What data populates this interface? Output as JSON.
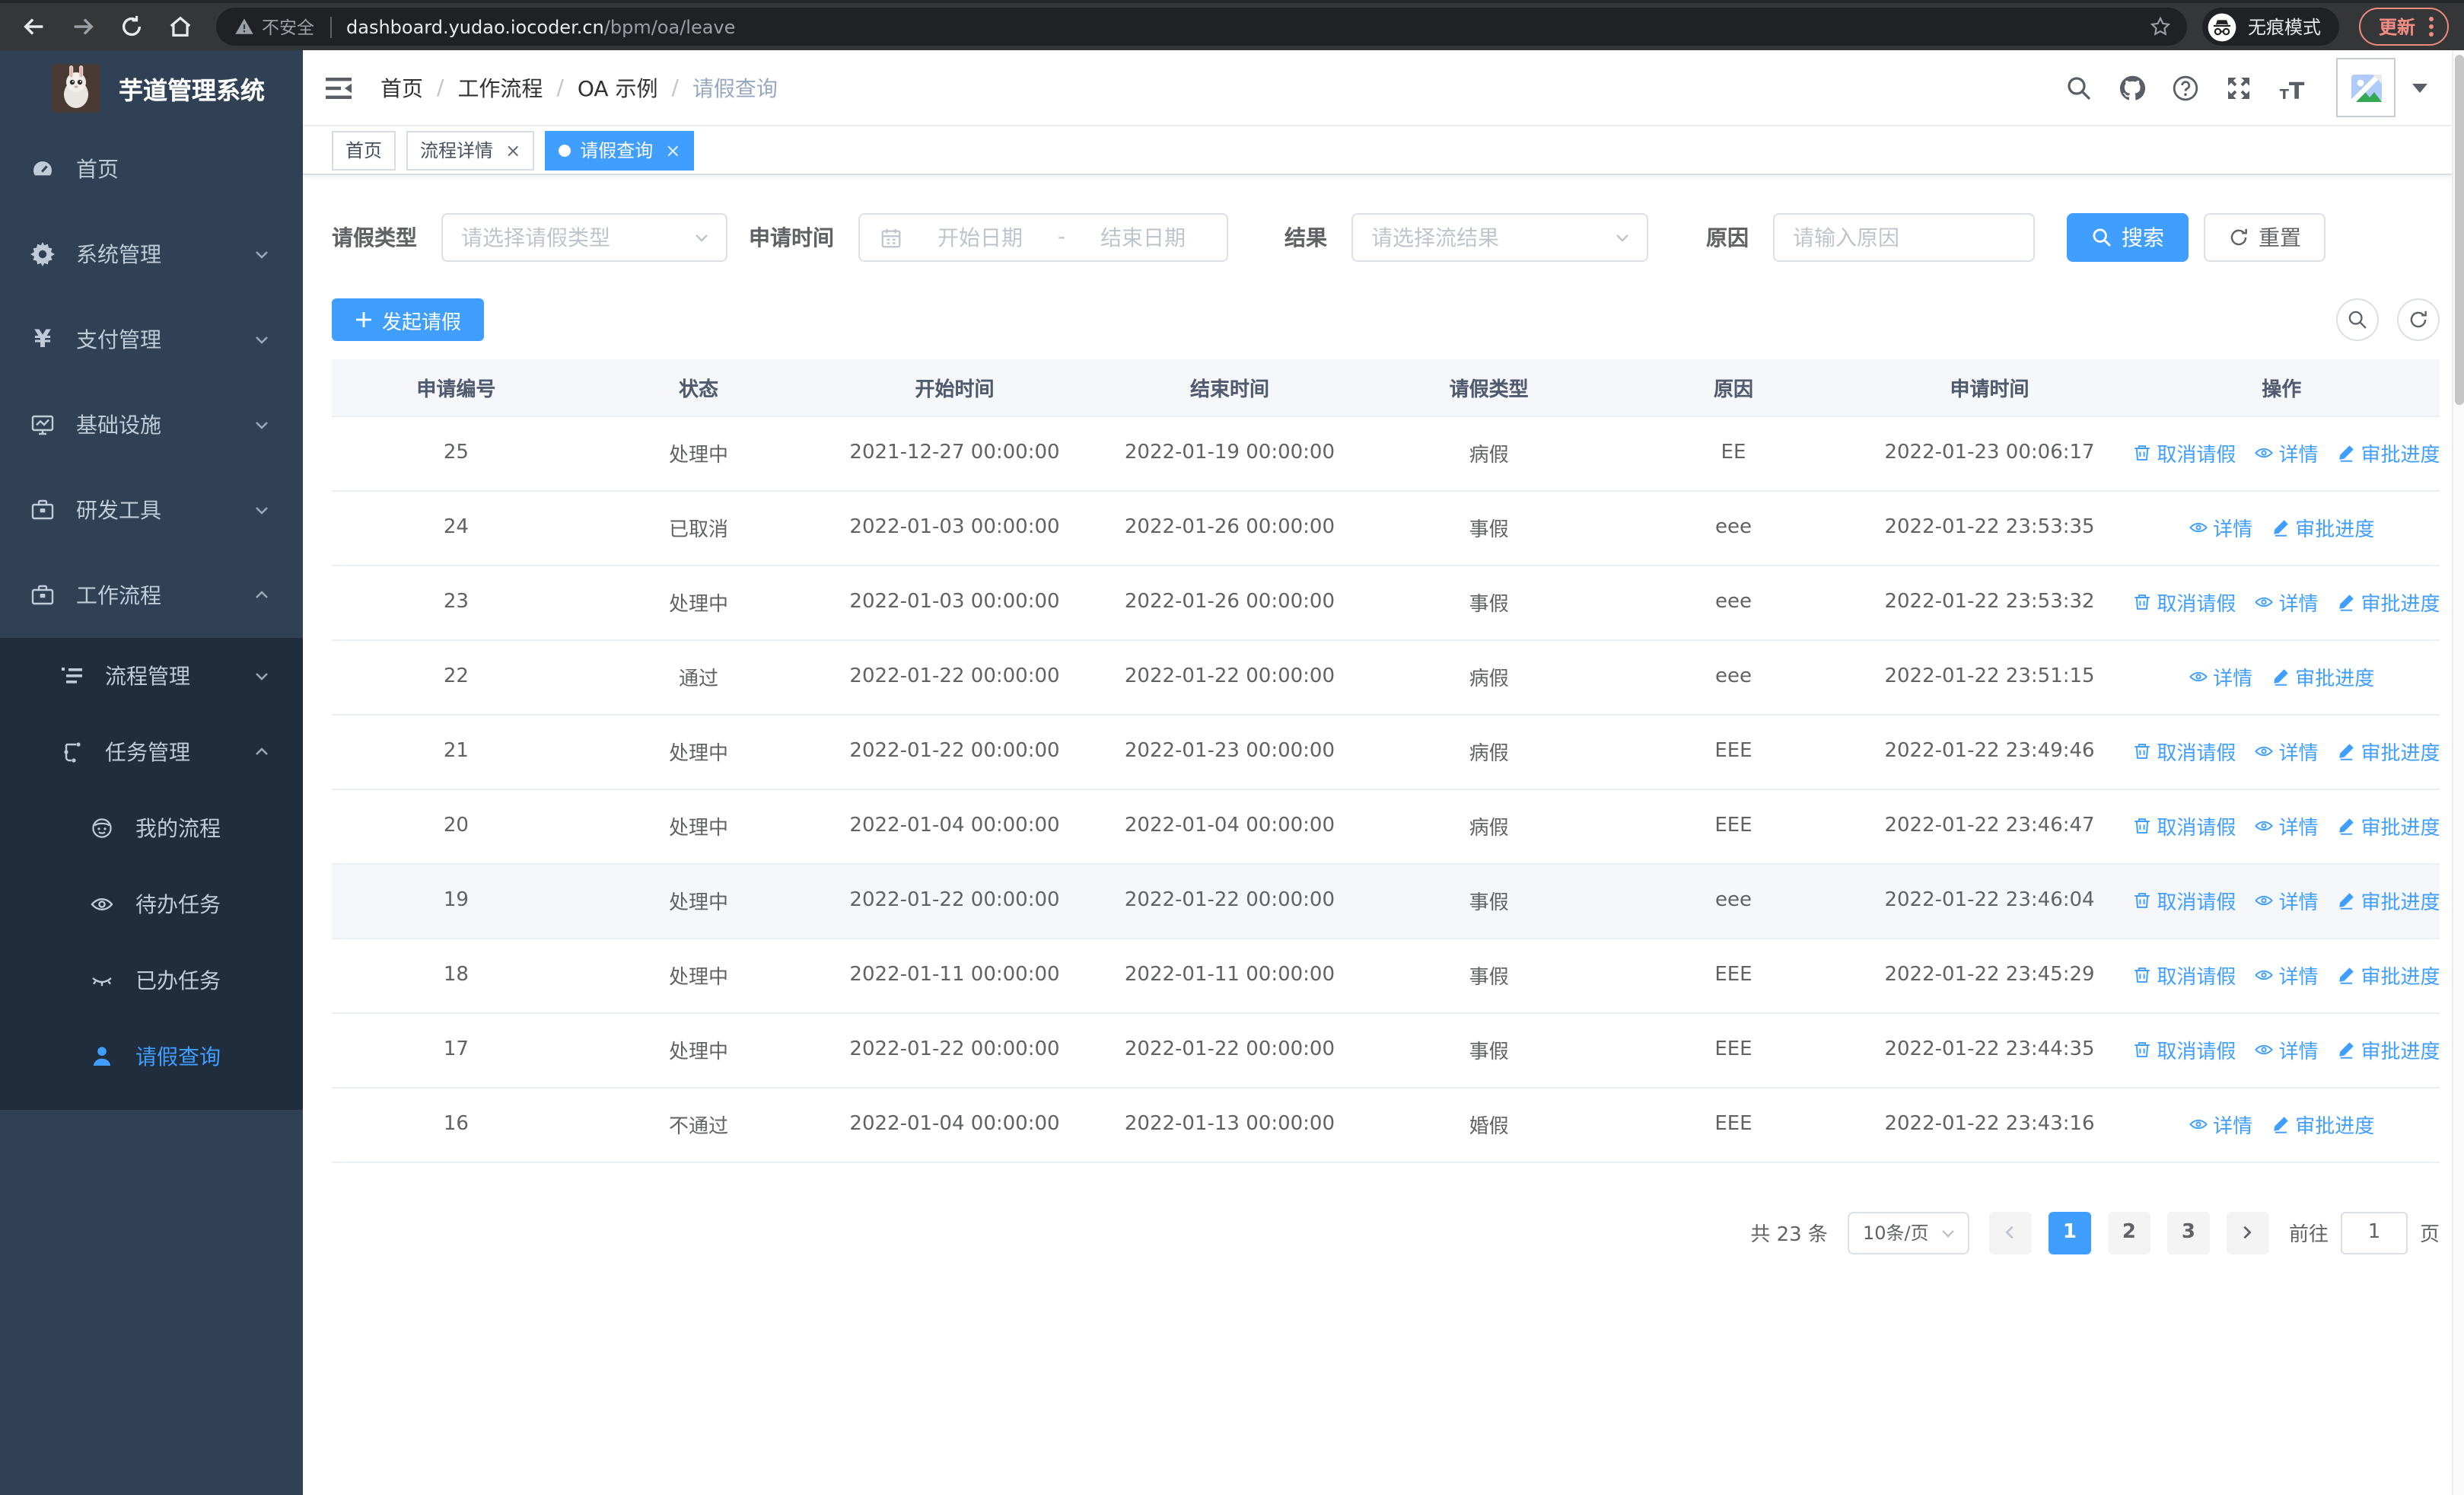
{
  "browser": {
    "security_chip": "不安全",
    "url_host": "dashboard.yudao.iocoder.cn",
    "url_path": "/bpm/oa/leave",
    "incognito_label": "无痕模式",
    "update_button": "更新"
  },
  "sidebar": {
    "app_title": "芋道管理系统",
    "menu": [
      {
        "label": "首页",
        "icon": "dashboard-icon",
        "level": 1
      },
      {
        "label": "系统管理",
        "icon": "gear-icon",
        "level": 1,
        "chevron": "down"
      },
      {
        "label": "支付管理",
        "icon": "yen-icon",
        "level": 1,
        "chevron": "down"
      },
      {
        "label": "基础设施",
        "icon": "monitor-icon",
        "level": 1,
        "chevron": "down"
      },
      {
        "label": "研发工具",
        "icon": "toolbox-icon",
        "level": 1,
        "chevron": "down"
      },
      {
        "label": "工作流程",
        "icon": "briefcase-icon",
        "level": 1,
        "chevron": "up"
      },
      {
        "label": "流程管理",
        "icon": "list-icon",
        "level": 2,
        "chevron": "down"
      },
      {
        "label": "任务管理",
        "icon": "tree-icon",
        "level": 2,
        "chevron": "up"
      },
      {
        "label": "我的流程",
        "icon": "robot-icon",
        "level": 3
      },
      {
        "label": "待办任务",
        "icon": "eye-icon",
        "level": 3
      },
      {
        "label": "已办任务",
        "icon": "eye-closed-icon",
        "level": 3
      },
      {
        "label": "请假查询",
        "icon": "user-icon",
        "level": 3,
        "active": true
      }
    ]
  },
  "header": {
    "breadcrumb": [
      "首页",
      "工作流程",
      "OA 示例",
      "请假查询"
    ]
  },
  "tabs": [
    {
      "label": "首页",
      "closable": false,
      "active": false
    },
    {
      "label": "流程详情",
      "closable": true,
      "active": false
    },
    {
      "label": "请假查询",
      "closable": true,
      "active": true
    }
  ],
  "filters": {
    "leave_type_label": "请假类型",
    "leave_type_placeholder": "请选择请假类型",
    "apply_time_label": "申请时间",
    "date_start_placeholder": "开始日期",
    "date_separator": "-",
    "date_end_placeholder": "结束日期",
    "result_label": "结果",
    "result_placeholder": "请选择流结果",
    "reason_label": "原因",
    "reason_placeholder": "请输入原因",
    "search_button": "搜索",
    "reset_button": "重置"
  },
  "toolbar": {
    "create_button": "发起请假"
  },
  "table": {
    "columns": [
      "申请编号",
      "状态",
      "开始时间",
      "结束时间",
      "请假类型",
      "原因",
      "申请时间",
      "操作"
    ],
    "col_widths": [
      "11.8%",
      "11.2%",
      "13.1%",
      "13%",
      "11.6%",
      "11.6%",
      "12.7%",
      "15%"
    ],
    "action_labels": {
      "cancel": "取消请假",
      "detail": "详情",
      "progress": "审批进度"
    },
    "rows": [
      {
        "id": "25",
        "status": "处理中",
        "start": "2021-12-27 00:00:00",
        "end": "2022-01-19 00:00:00",
        "type": "病假",
        "reason": "EE",
        "apply_time": "2022-01-23 00:06:17",
        "actions": [
          "cancel",
          "detail",
          "progress"
        ],
        "highlight": false
      },
      {
        "id": "24",
        "status": "已取消",
        "start": "2022-01-03 00:00:00",
        "end": "2022-01-26 00:00:00",
        "type": "事假",
        "reason": "eee",
        "apply_time": "2022-01-22 23:53:35",
        "actions": [
          "detail",
          "progress"
        ],
        "highlight": false
      },
      {
        "id": "23",
        "status": "处理中",
        "start": "2022-01-03 00:00:00",
        "end": "2022-01-26 00:00:00",
        "type": "事假",
        "reason": "eee",
        "apply_time": "2022-01-22 23:53:32",
        "actions": [
          "cancel",
          "detail",
          "progress"
        ],
        "highlight": false
      },
      {
        "id": "22",
        "status": "通过",
        "start": "2022-01-22 00:00:00",
        "end": "2022-01-22 00:00:00",
        "type": "病假",
        "reason": "eee",
        "apply_time": "2022-01-22 23:51:15",
        "actions": [
          "detail",
          "progress"
        ],
        "highlight": false
      },
      {
        "id": "21",
        "status": "处理中",
        "start": "2022-01-22 00:00:00",
        "end": "2022-01-23 00:00:00",
        "type": "病假",
        "reason": "EEE",
        "apply_time": "2022-01-22 23:49:46",
        "actions": [
          "cancel",
          "detail",
          "progress"
        ],
        "highlight": false
      },
      {
        "id": "20",
        "status": "处理中",
        "start": "2022-01-04 00:00:00",
        "end": "2022-01-04 00:00:00",
        "type": "病假",
        "reason": "EEE",
        "apply_time": "2022-01-22 23:46:47",
        "actions": [
          "cancel",
          "detail",
          "progress"
        ],
        "highlight": false
      },
      {
        "id": "19",
        "status": "处理中",
        "start": "2022-01-22 00:00:00",
        "end": "2022-01-22 00:00:00",
        "type": "事假",
        "reason": "eee",
        "apply_time": "2022-01-22 23:46:04",
        "actions": [
          "cancel",
          "detail",
          "progress"
        ],
        "highlight": true
      },
      {
        "id": "18",
        "status": "处理中",
        "start": "2022-01-11 00:00:00",
        "end": "2022-01-11 00:00:00",
        "type": "事假",
        "reason": "EEE",
        "apply_time": "2022-01-22 23:45:29",
        "actions": [
          "cancel",
          "detail",
          "progress"
        ],
        "highlight": false
      },
      {
        "id": "17",
        "status": "处理中",
        "start": "2022-01-22 00:00:00",
        "end": "2022-01-22 00:00:00",
        "type": "事假",
        "reason": "EEE",
        "apply_time": "2022-01-22 23:44:35",
        "actions": [
          "cancel",
          "detail",
          "progress"
        ],
        "highlight": false
      },
      {
        "id": "16",
        "status": "不通过",
        "start": "2022-01-04 00:00:00",
        "end": "2022-01-13 00:00:00",
        "type": "婚假",
        "reason": "EEE",
        "apply_time": "2022-01-22 23:43:16",
        "actions": [
          "detail",
          "progress"
        ],
        "highlight": false
      }
    ]
  },
  "pagination": {
    "total_text": "共 23 条",
    "page_size": "10条/页",
    "pages": [
      "1",
      "2",
      "3"
    ],
    "active_page": "1",
    "goto_label": "前往",
    "goto_value": "1",
    "goto_suffix": "页"
  },
  "colors": {
    "accent": "#409eff",
    "sidebar_bg": "#304156",
    "submenu_bg": "#1f2d3d",
    "sidebar_text": "#bfcbd9",
    "table_header_bg": "#f5f7fa",
    "row_highlight": "#f5f7fa",
    "update_chip": "#f28b82"
  }
}
